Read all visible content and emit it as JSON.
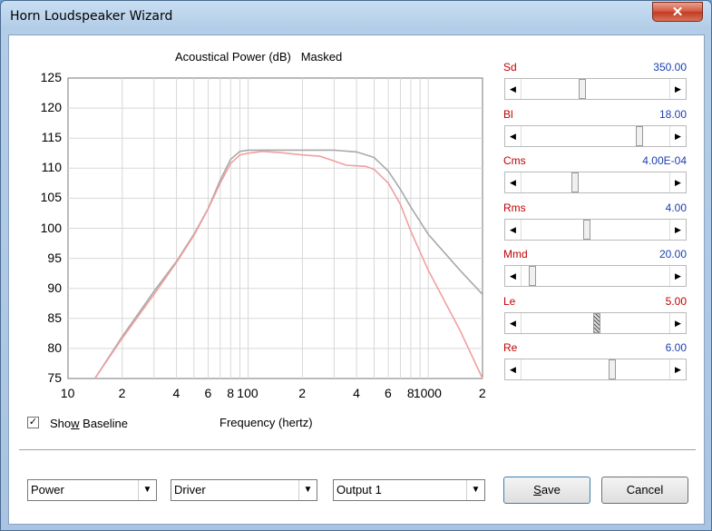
{
  "window": {
    "title": "Horn Loudspeaker Wizard",
    "close_glyph": "✕"
  },
  "chart_title": "Acoustical Power (dB)   Masked",
  "chart_data": {
    "type": "line",
    "title": "Acoustical Power (dB)   Masked",
    "xlabel": "Frequency (hertz)",
    "ylabel": "",
    "xscale": "log",
    "xlim": [
      10,
      2000
    ],
    "ylim": [
      75,
      125
    ],
    "y_ticks": [
      125,
      120,
      115,
      110,
      105,
      100,
      95,
      90,
      85,
      80,
      75
    ],
    "x_tick_labels": [
      "10",
      "2",
      "4",
      "6",
      "8",
      "100",
      "2",
      "4",
      "6",
      "8",
      "1000",
      "2"
    ],
    "grid": true,
    "series": [
      {
        "color": "#a8a8a8",
        "x": [
          14.1,
          20,
          30,
          40,
          50,
          60,
          70,
          80,
          90,
          100,
          150,
          200,
          300,
          400,
          500,
          600,
          700,
          800,
          1000,
          1500,
          2000
        ],
        "y": [
          75,
          82,
          89.5,
          94.5,
          99,
          103.3,
          108,
          111.5,
          112.8,
          113,
          113,
          113,
          113,
          112.7,
          111.8,
          109.5,
          106.5,
          103.5,
          99,
          93,
          89
        ]
      },
      {
        "color": "#f0a0a0",
        "x": [
          14.1,
          20,
          30,
          40,
          50,
          60,
          70,
          80,
          90,
          100,
          120,
          150,
          200,
          250,
          300,
          350,
          400,
          450,
          500,
          600,
          700,
          800,
          1000,
          1500,
          2000
        ],
        "y": [
          75,
          81.7,
          89,
          94.3,
          98.8,
          103.2,
          107.5,
          110.8,
          112.2,
          112.5,
          112.8,
          112.6,
          112.2,
          112,
          111.2,
          110.5,
          110.4,
          110.3,
          109.8,
          107.5,
          104,
          99.5,
          93,
          83,
          75
        ]
      }
    ]
  },
  "baseline": {
    "checked": true,
    "label": "Show Baseline",
    "check_glyph": "✓"
  },
  "xlabel": "Frequency (hertz)",
  "params": [
    {
      "name": "Sd",
      "value": "350.00",
      "pos": 0.4
    },
    {
      "name": "Bl",
      "value": "18.00",
      "pos": 0.8
    },
    {
      "name": "Cms",
      "value": "4.00E-04",
      "pos": 0.35
    },
    {
      "name": "Rms",
      "value": "4.00",
      "pos": 0.43
    },
    {
      "name": "Mmd",
      "value": "20.00",
      "pos": 0.05
    },
    {
      "name": "Le",
      "value": "5.00",
      "pos": 0.5
    },
    {
      "name": "Re",
      "value": "6.00",
      "pos": 0.61
    }
  ],
  "combos": [
    {
      "value": "Power"
    },
    {
      "value": "Driver"
    },
    {
      "value": "Output 1"
    }
  ],
  "buttons": {
    "save": "Save",
    "cancel": "Cancel"
  },
  "icons": {
    "left_arrow": "◀",
    "right_arrow": "▶",
    "down_arrow": "▼"
  }
}
